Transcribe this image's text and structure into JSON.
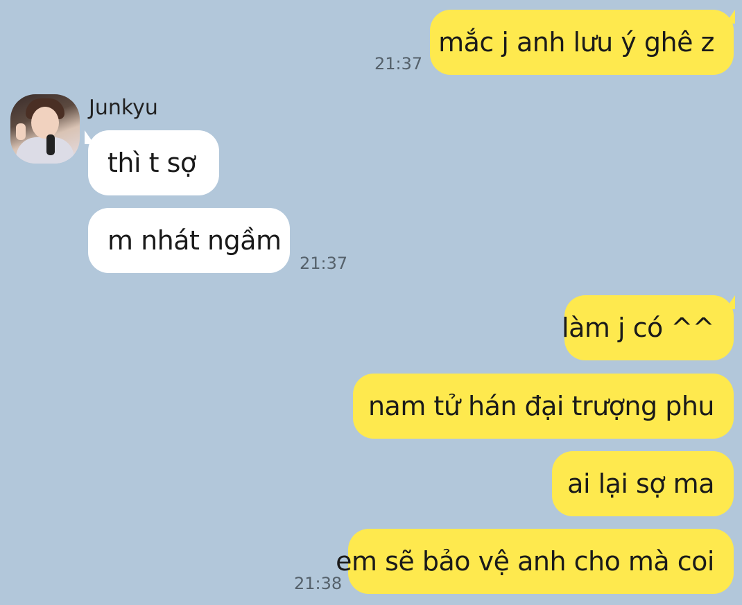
{
  "chat": {
    "contact_name": "Junkyu",
    "messages": [
      {
        "text": "mắc j anh lưu ý ghê z",
        "time": "21:37",
        "sender": "me"
      },
      {
        "text": "thì t sợ",
        "time": "",
        "sender": "Junkyu"
      },
      {
        "text": "m nhát ngầm",
        "time": "21:37",
        "sender": "Junkyu"
      },
      {
        "text": "làm j có ^^",
        "time": "",
        "sender": "me"
      },
      {
        "text": "nam tử hán đại trượng phu",
        "time": "",
        "sender": "me"
      },
      {
        "text": "ai lại sợ ma",
        "time": "",
        "sender": "me"
      },
      {
        "text": "em sẽ bảo vệ anh cho mà coi",
        "time": "21:38",
        "sender": "me"
      }
    ]
  },
  "colors": {
    "background": "#b2c7da",
    "outgoing_bubble": "#fee94e",
    "incoming_bubble": "#ffffff",
    "timestamp": "#55616b"
  },
  "icons": {
    "contact_avatar": "profile-photo"
  }
}
